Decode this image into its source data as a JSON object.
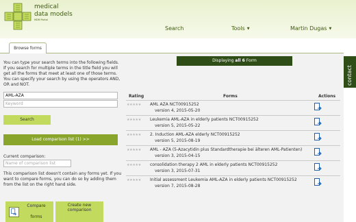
{
  "brand": {
    "line1": "medical",
    "line2": "data models",
    "sub": "MDM Portal"
  },
  "nav": {
    "search": "Search",
    "tools": "Tools",
    "user": "Martin Dugas"
  },
  "tab": "Browse forms",
  "intro_text": "You can type your search terms into the following fields. If you search for multiple terms in the title field you will get all the forms that meet at least one of those terms. You can specify your search by using the operators AND, OR and NOT.",
  "search": {
    "title_value": "AML-AZA",
    "keyword_placeholder": "Keyword",
    "button": "Search"
  },
  "load_button": "Load comparison list (1) >>",
  "comparison": {
    "label": "Current comparison:",
    "name_placeholder": "Name of comparison list",
    "note": "This comparison list doesn't contain any forms yet. If you want to compare forms, you can do so by adding them from the list on the right hand side."
  },
  "buttons": {
    "compare_line1": "Compare",
    "compare_line2": "forms",
    "create": "Create new comparison"
  },
  "display": {
    "prefix": "Displaying",
    "bold": "all 6",
    "suffix": "Form"
  },
  "table": {
    "headers": {
      "rating": "Rating",
      "forms": "Forms",
      "actions": "Actions"
    },
    "rows": [
      {
        "title": "AML AZA NCT00915252",
        "version": "version 4, 2015-05-20"
      },
      {
        "title": "Leukemia AML-AZA in elderly patients NCT00915252",
        "version": "version 5, 2015-05-22"
      },
      {
        "title": "2. Induction AML-AZA elderly NCT00915252",
        "version": "version 5, 2015-08-19"
      },
      {
        "title": "AML - AZA (5-Azacytidin plus Standardtherapie bei älteren AML-Patienten)",
        "version": "version 3, 2015-04-15"
      },
      {
        "title": "consolidation therapy 2 AML in elderly patients NCT00915252",
        "version": "version 3, 2015-07-31"
      },
      {
        "title": "Initial assessment Leukemia AML-AZA in elderly patients NCT00915252",
        "version": "version 7, 2015-08-28"
      }
    ]
  },
  "contact": "contact",
  "icons": {
    "logo": "plus-grid-logo-icon",
    "stars": "rating-stars-icon",
    "action": "add-form-document-icon",
    "compare": "compare-forms-icon"
  },
  "colors": {
    "accent": "#c2da5d",
    "dark_green": "#2f4d16",
    "mid_green": "#8aa52c"
  }
}
